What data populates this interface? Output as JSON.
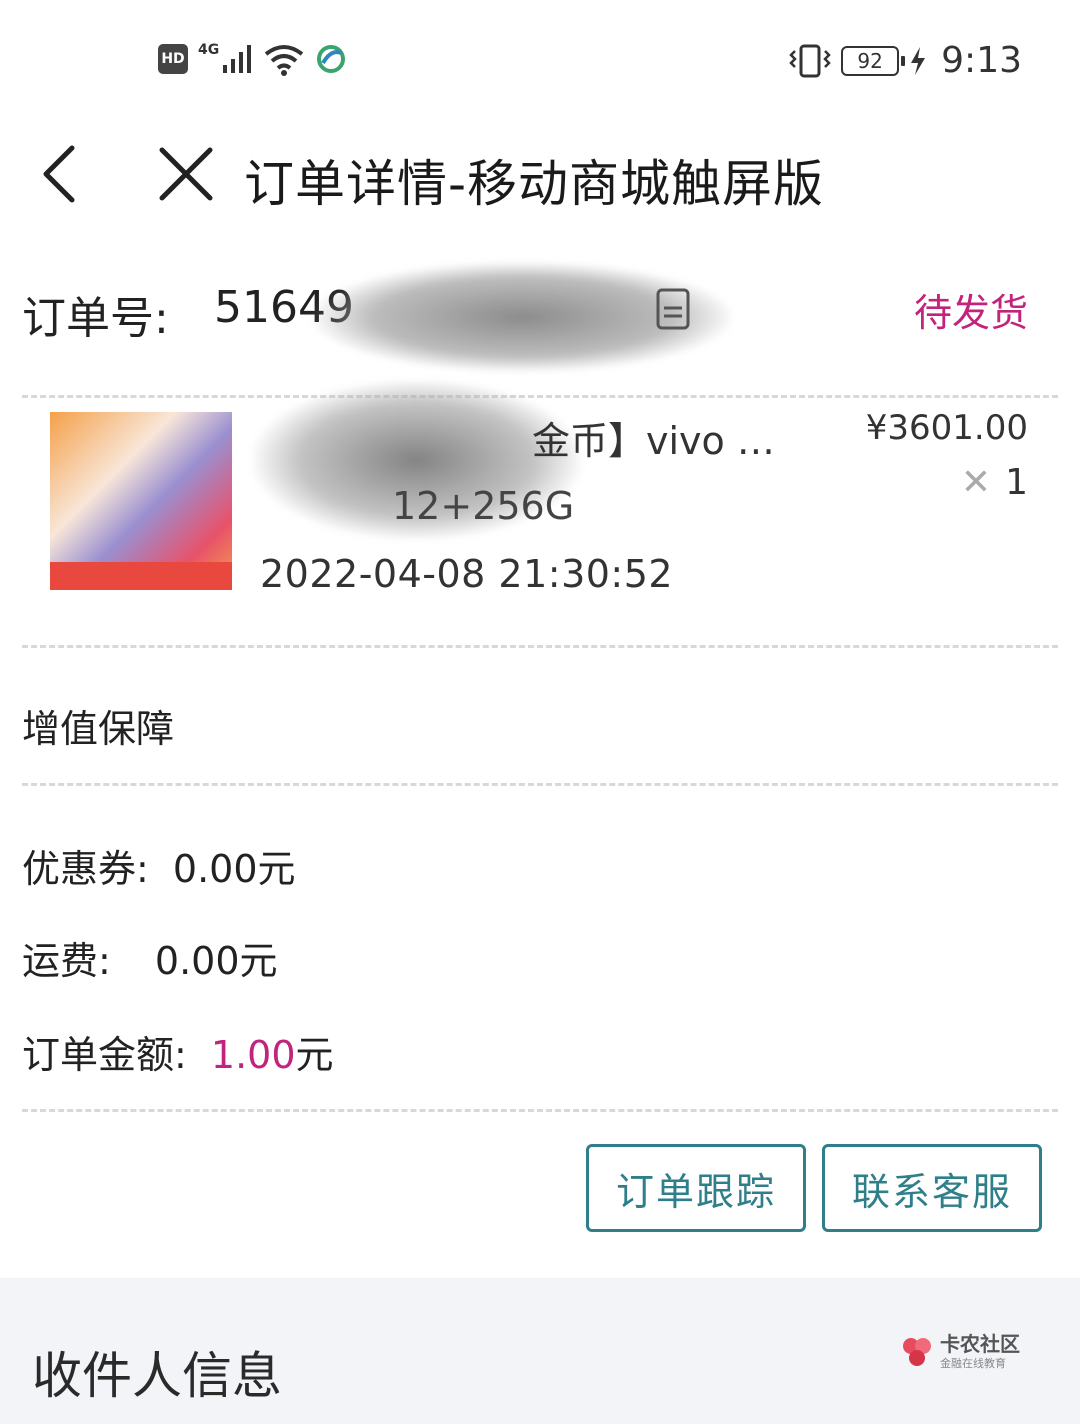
{
  "status_bar": {
    "hd": "HD",
    "network": "4G",
    "battery": "92",
    "time": "9:13"
  },
  "header": {
    "title": "订单详情-移动商城触屏版"
  },
  "order": {
    "label": "订单号:",
    "number_visible": "51649",
    "status": "待发货"
  },
  "product": {
    "name_visible": "金币】vivo …",
    "spec_visible": "12+256G",
    "time": "2022-04-08 21:30:52",
    "price": "¥3601.00",
    "qty": "1"
  },
  "value_added": {
    "label": "增值保障"
  },
  "fees": {
    "coupon_label": "优惠券:",
    "coupon_value": "0.00元",
    "shipping_label": "运费:",
    "shipping_value": "0.00元",
    "total_label": "订单金额:",
    "total_amount": "1.00",
    "total_unit": "元"
  },
  "actions": {
    "track": "订单跟踪",
    "service": "联系客服"
  },
  "receiver": {
    "title": "收件人信息"
  },
  "watermark": {
    "main": "卡农社区",
    "sub": "金融在线教育"
  },
  "colors": {
    "accent_pink": "#c2237c",
    "button_teal": "#2f7f8a",
    "section_bg": "#f2f4f8"
  }
}
